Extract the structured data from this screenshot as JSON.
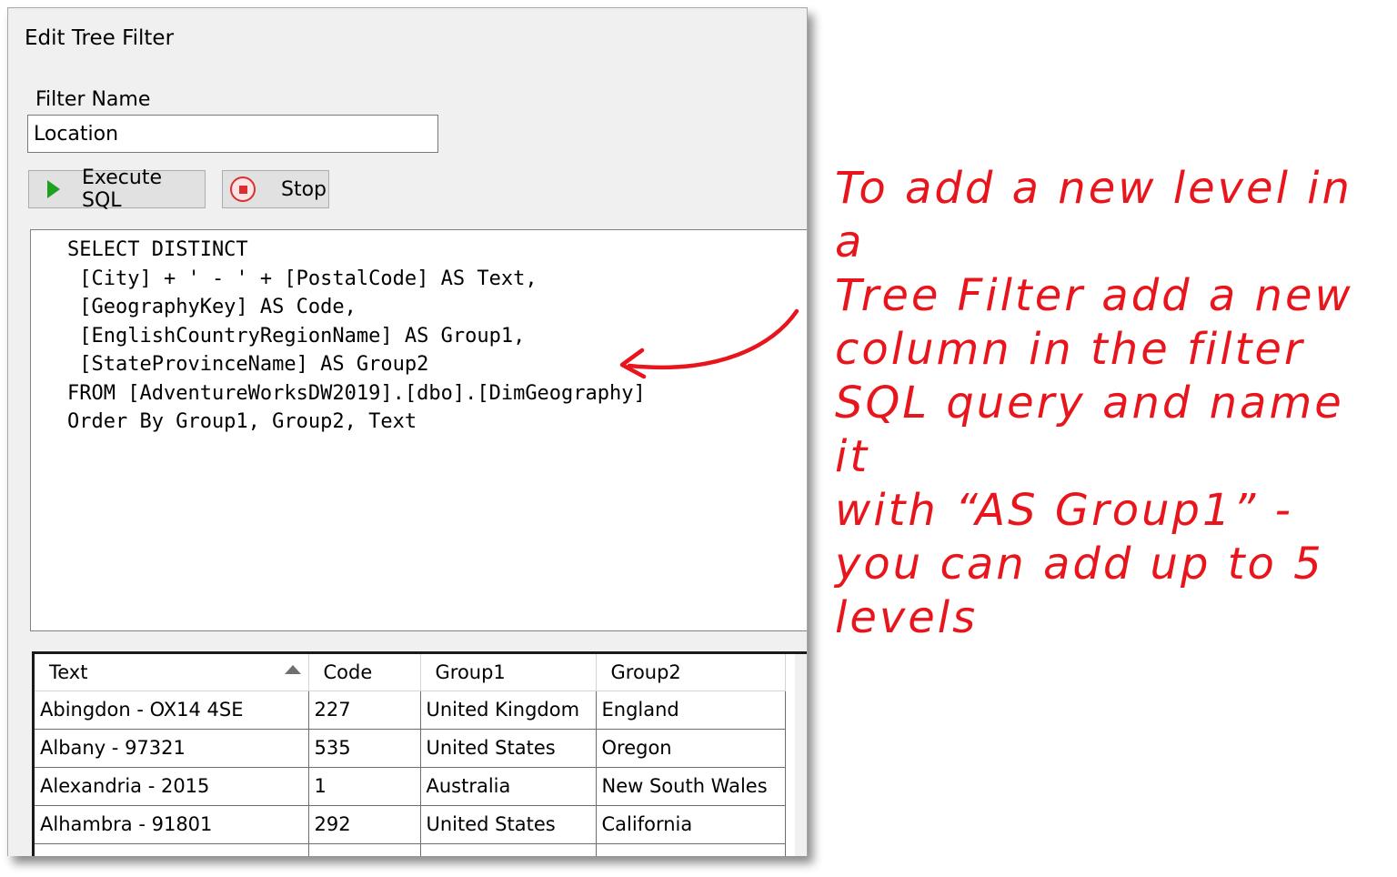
{
  "dialog": {
    "title": "Edit Tree Filter",
    "filter_name_label": "Filter Name",
    "filter_name_value": "Location",
    "execute_label": "Execute SQL",
    "stop_label": "Stop",
    "sql_lines": [
      "SELECT DISTINCT",
      " [City] + ' - ' + [PostalCode] AS Text,",
      " [GeographyKey] AS Code,",
      " [EnglishCountryRegionName] AS Group1,",
      " [StateProvinceName] AS Group2",
      "FROM [AdventureWorksDW2019].[dbo].[DimGeography]",
      "Order By Group1, Group2, Text"
    ]
  },
  "grid": {
    "columns": [
      "Text",
      "Code",
      "Group1",
      "Group2"
    ],
    "rows": [
      [
        "Abingdon - OX14 4SE",
        "227",
        "United Kingdom",
        "England"
      ],
      [
        "Albany - 97321",
        "535",
        "United States",
        "Oregon"
      ],
      [
        "Alexandria - 2015",
        "1",
        "Australia",
        "New South Wales"
      ],
      [
        "Alhambra - 91801",
        "292",
        "United States",
        "California"
      ],
      [
        "",
        "",
        "",
        ""
      ]
    ]
  },
  "annotation": {
    "lines": [
      "To add a new level in a",
      "Tree Filter add a new",
      "column in the filter",
      "SQL query and name it",
      "with “AS Group1” -",
      "you can add up to 5",
      "levels"
    ],
    "color": "#e8161c"
  }
}
